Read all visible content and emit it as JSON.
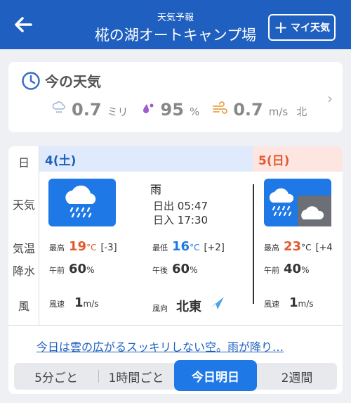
{
  "header": {
    "subtitle": "天気予報",
    "title": "椛の湖オートキャンプ場",
    "my_weather_plus": "+",
    "my_weather_label": "マイ天気"
  },
  "now": {
    "title": "今の天気",
    "precip_value": "0.7",
    "precip_unit": "ミリ",
    "humidity_value": "95",
    "humidity_unit": "%",
    "wind_value": "0.7",
    "wind_unit": "m/s",
    "wind_dir": "北"
  },
  "labels": {
    "day": "日",
    "weather": "天気",
    "temp": "気温",
    "precip": "降水",
    "wind": "風"
  },
  "day1": {
    "header": "4(土)",
    "condition": "雨",
    "sunrise_label": "日出",
    "sunrise": "05:47",
    "sunset_label": "日入",
    "sunset": "17:30",
    "high_label": "最高",
    "high": "19",
    "high_unit": "°C",
    "high_diff": "[-3]",
    "low_label": "最低",
    "low": "16",
    "low_unit": "°C",
    "low_diff": "[+2]",
    "am_label": "午前",
    "am": "60",
    "pm_label": "午後",
    "pm": "60",
    "pct": "%",
    "wind_speed_label": "風速",
    "wind_speed": "1",
    "wind_unit": "m/s",
    "wind_dir_label": "風向",
    "wind_dir": "北東"
  },
  "day2": {
    "header": "5(日)",
    "high_label": "最高",
    "high": "23",
    "high_unit": "°C",
    "high_diff": "[+4",
    "am_label": "午前",
    "am": "40",
    "pct": "%",
    "wind_speed_label": "風速",
    "wind_speed": "1",
    "wind_unit": "m/s"
  },
  "summary": "今日は雲の広がるスッキリしない空。雨が降り…",
  "tabs": [
    "5分ごと",
    "1時間ごと",
    "今日明日",
    "2週間"
  ],
  "colors": {
    "brand": "#1e5fbf",
    "accent": "#1e78e6",
    "sunday": "#e25a2f"
  }
}
